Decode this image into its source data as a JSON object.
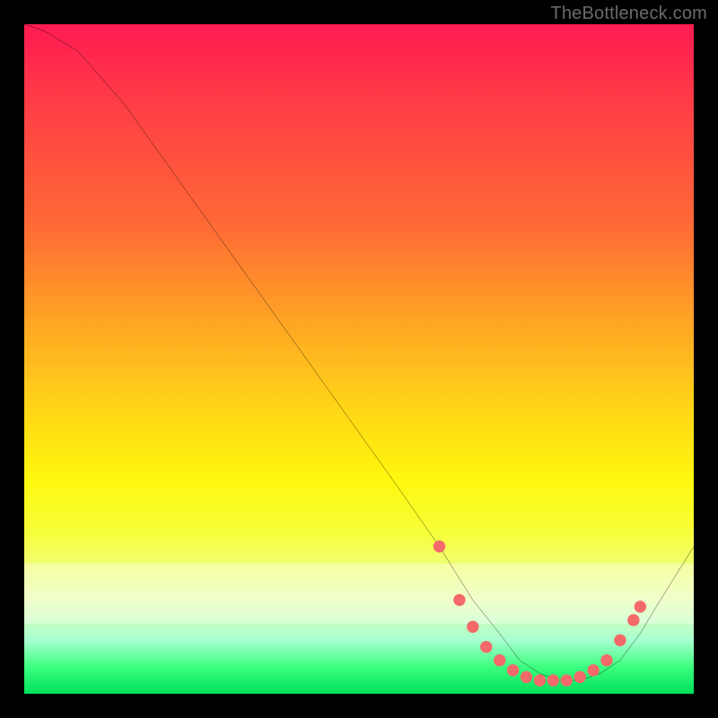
{
  "watermark": "TheBottleneck.com",
  "chart_data": {
    "type": "line",
    "title": "",
    "xlabel": "",
    "ylabel": "",
    "xlim": [
      0,
      100
    ],
    "ylim": [
      0,
      100
    ],
    "grid": false,
    "legend": false,
    "series": [
      {
        "name": "bottleneck-curve",
        "x": [
          0,
          3,
          8,
          15,
          25,
          35,
          45,
          55,
          62,
          67,
          71,
          74,
          77,
          80,
          83,
          86,
          89,
          92,
          95,
          100
        ],
        "y": [
          100,
          99,
          96,
          88,
          74,
          60,
          46,
          32,
          22,
          14,
          9,
          5,
          3,
          2,
          2,
          3,
          5,
          9,
          14,
          22
        ]
      }
    ],
    "markers": {
      "comment": "salmon dots along the valley bottom",
      "name": "valley-points",
      "color": "#f46a6a",
      "points": [
        {
          "x": 62,
          "y": 22
        },
        {
          "x": 65,
          "y": 14
        },
        {
          "x": 67,
          "y": 10
        },
        {
          "x": 69,
          "y": 7
        },
        {
          "x": 71,
          "y": 5
        },
        {
          "x": 73,
          "y": 3.5
        },
        {
          "x": 75,
          "y": 2.5
        },
        {
          "x": 77,
          "y": 2
        },
        {
          "x": 79,
          "y": 2
        },
        {
          "x": 81,
          "y": 2
        },
        {
          "x": 83,
          "y": 2.5
        },
        {
          "x": 85,
          "y": 3.5
        },
        {
          "x": 87,
          "y": 5
        },
        {
          "x": 89,
          "y": 8
        },
        {
          "x": 91,
          "y": 11
        },
        {
          "x": 92,
          "y": 13
        }
      ]
    }
  }
}
